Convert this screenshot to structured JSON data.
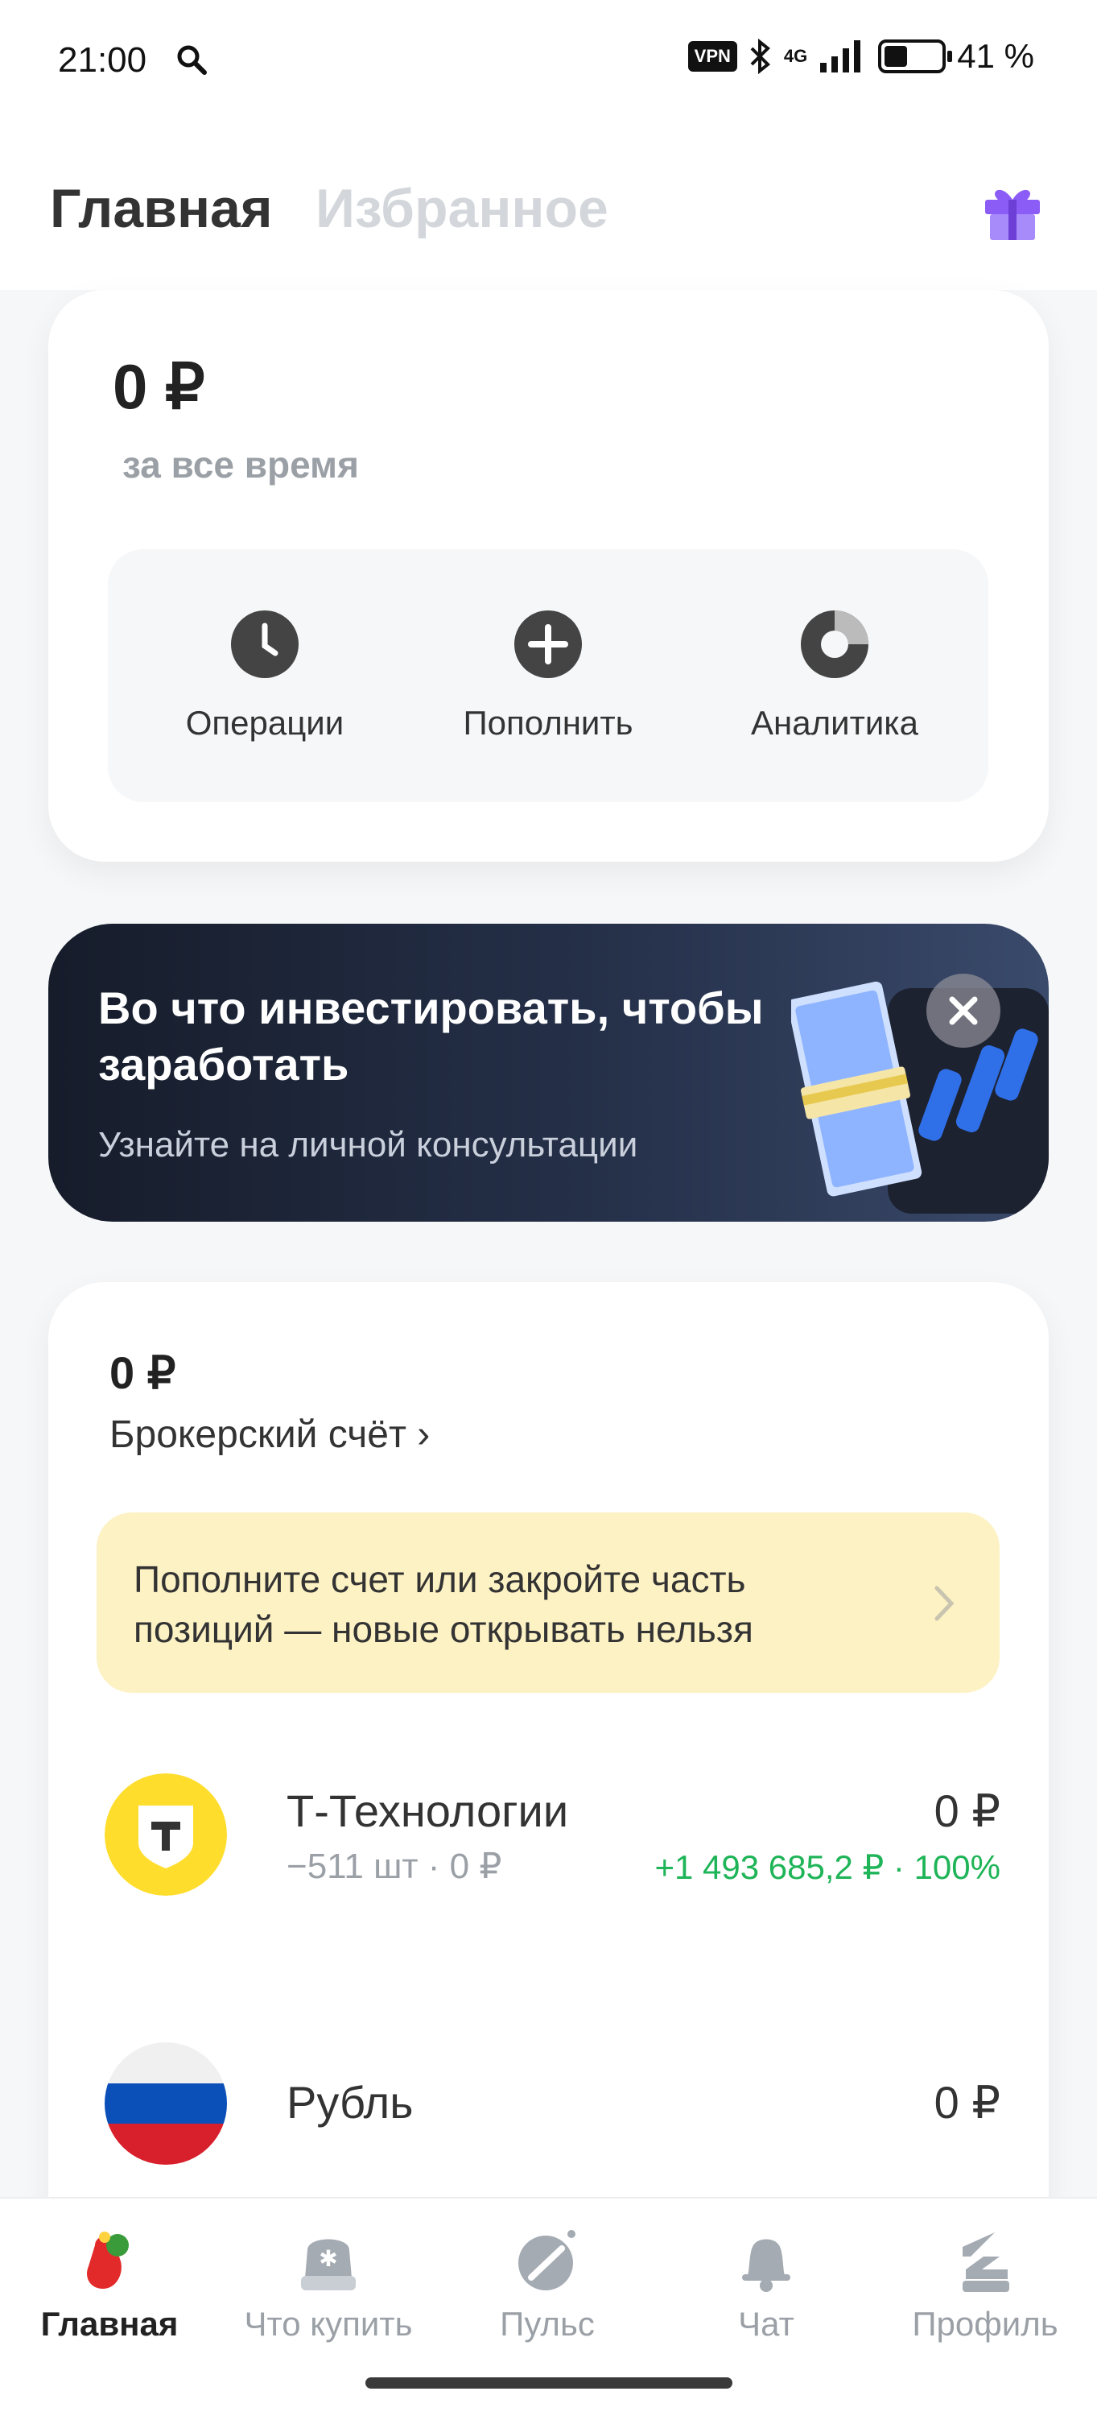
{
  "status_bar": {
    "time": "21:00",
    "vpn": "VPN",
    "network": "4G",
    "battery": "41 %",
    "battery_level": 0.41,
    "icons": [
      "search-icon",
      "bluetooth-icon",
      "signal-icon",
      "battery-icon"
    ]
  },
  "header": {
    "tab_main": "Главная",
    "tab_favorites": "Избранное",
    "gift_icon": "gift-icon",
    "gift_color": "#8b5cf6"
  },
  "summary": {
    "amount": "0 ₽",
    "period": "за все время",
    "actions": [
      {
        "label": "Операции",
        "icon": "clock-icon"
      },
      {
        "label": "Пополнить",
        "icon": "plus-icon"
      },
      {
        "label": "Аналитика",
        "icon": "donut-chart-icon"
      }
    ]
  },
  "banner": {
    "title": "Во что инвестировать, чтобы заработать",
    "subtitle": "Узнайте на личной консультации",
    "art_icon": "money-stack-icon",
    "close_icon": "close-icon"
  },
  "broker": {
    "amount": "0 ₽",
    "account_link": "Брокерский счёт ›",
    "notice": "Пополните счет или закройте часть позиций — новые открывать нельзя",
    "assets": [
      {
        "name": "Т-Технологии",
        "detail": "−511 шт · 0 ₽",
        "value": "0 ₽",
        "change": "+1 493 685,2 ₽ · 100%",
        "logo": "t-bank-logo"
      },
      {
        "name": "Рубль",
        "detail": "",
        "value": "0 ₽",
        "change": "",
        "logo": "russia-flag-icon"
      }
    ]
  },
  "bottom_nav": {
    "items": [
      {
        "label": "Главная",
        "icon": "home-mitten-icon",
        "active": true
      },
      {
        "label": "Что купить",
        "icon": "bag-icon",
        "active": false
      },
      {
        "label": "Пульс",
        "icon": "pulse-icon",
        "active": false
      },
      {
        "label": "Чат",
        "icon": "bell-chat-icon",
        "active": false
      },
      {
        "label": "Профиль",
        "icon": "profile-icon",
        "active": false
      }
    ]
  },
  "colors": {
    "accent_green": "#1eb457",
    "notice_bg": "#fdf2c4",
    "brand_yellow": "#ffdd2d",
    "banner_dark": "#161c2a"
  }
}
